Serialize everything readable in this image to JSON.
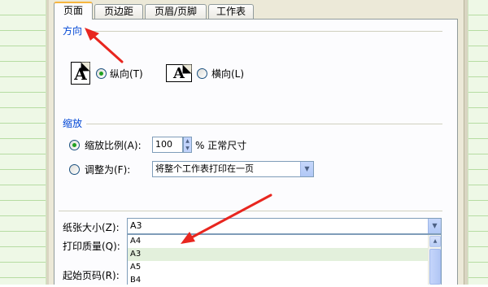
{
  "tabs": [
    "页面",
    "页边距",
    "页眉/页脚",
    "工作表"
  ],
  "orientation": {
    "title": "方向",
    "icon_glyph": "A",
    "portrait_label": "纵向(T)",
    "landscape_label": "横向(L)",
    "selected": "portrait"
  },
  "scaling": {
    "title": "缩放",
    "adjust_to_label": "缩放比例(A):",
    "adjust_to_value": "100",
    "adjust_to_suffix": "% 正常尺寸",
    "fit_to_label": "调整为(F):",
    "fit_to_value": "将整个工作表打印在一页",
    "selected": "adjust_to"
  },
  "paper": {
    "size_label": "纸张大小(Z):",
    "size_value": "A3",
    "quality_label": "打印质量(Q):",
    "first_page_label": "起始页码(R):",
    "size_options": [
      "A4",
      "A3",
      "A5",
      "B4"
    ],
    "highlighted_option": "A3"
  },
  "icons": {
    "spin_up": "▲",
    "spin_down": "▼",
    "dropdown": "▼",
    "scroll_up": "▲",
    "scroll_down": "▼"
  },
  "colors": {
    "section_title": "#0046d5",
    "annotation_arrow": "#e8261f",
    "active_tab_top": "#f6b53f",
    "selection_highlight": "#e3f0dc"
  }
}
